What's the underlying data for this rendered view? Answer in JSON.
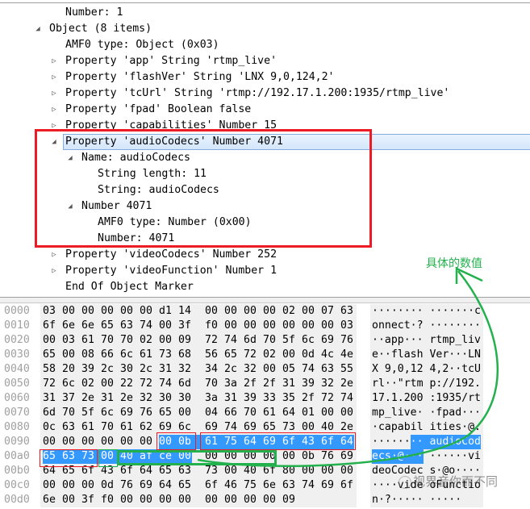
{
  "tree": [
    {
      "text": "Number: 1",
      "level": 2,
      "toggle": "none"
    },
    {
      "text": "Object (8 items)",
      "level": 1,
      "toggle": "expanded"
    },
    {
      "text": "AMF0 type: Object (0x03)",
      "level": 2,
      "toggle": "none"
    },
    {
      "text": "Property 'app' String 'rtmp_live'",
      "level": 2,
      "toggle": "collapsed"
    },
    {
      "text": "Property 'flashVer' String 'LNX 9,0,124,2'",
      "level": 2,
      "toggle": "collapsed"
    },
    {
      "text": "Property 'tcUrl' String 'rtmp://192.17.1.200:1935/rtmp_live'",
      "level": 2,
      "toggle": "collapsed"
    },
    {
      "text": "Property 'fpad' Boolean false",
      "level": 2,
      "toggle": "collapsed"
    },
    {
      "text": "Property 'capabilities' Number 15",
      "level": 2,
      "toggle": "collapsed"
    },
    {
      "text": "Property 'audioCodecs' Number 4071",
      "level": 2,
      "toggle": "expanded",
      "selected": true
    },
    {
      "text": "Name: audioCodecs",
      "level": 3,
      "toggle": "expanded"
    },
    {
      "text": "String length: 11",
      "level": 4,
      "toggle": "none"
    },
    {
      "text": "String: audioCodecs",
      "level": 4,
      "toggle": "none"
    },
    {
      "text": "Number 4071",
      "level": 3,
      "toggle": "expanded"
    },
    {
      "text": "AMF0 type: Number (0x00)",
      "level": 4,
      "toggle": "none"
    },
    {
      "text": "Number: 4071",
      "level": 4,
      "toggle": "none"
    },
    {
      "text": "Property 'videoCodecs' Number 252",
      "level": 2,
      "toggle": "collapsed"
    },
    {
      "text": "Property 'videoFunction' Number 1",
      "level": 2,
      "toggle": "collapsed"
    },
    {
      "text": "End Of Object Marker",
      "level": 2,
      "toggle": "none"
    }
  ],
  "hex_rows": [
    {
      "offset": "0000",
      "bytes": [
        "03",
        "00",
        "00",
        "00",
        "00",
        "00",
        "d1",
        "14",
        "00",
        "00",
        "00",
        "00",
        "02",
        "00",
        "07",
        "63"
      ],
      "ascii": "········ ·······c"
    },
    {
      "offset": "0010",
      "bytes": [
        "6f",
        "6e",
        "6e",
        "65",
        "63",
        "74",
        "00",
        "3f",
        "f0",
        "00",
        "00",
        "00",
        "00",
        "00",
        "00",
        "03"
      ],
      "ascii": "onnect·? ········"
    },
    {
      "offset": "0020",
      "bytes": [
        "00",
        "03",
        "61",
        "70",
        "70",
        "02",
        "00",
        "09",
        "72",
        "74",
        "6d",
        "70",
        "5f",
        "6c",
        "69",
        "76"
      ],
      "ascii": "··app··· rtmp_liv"
    },
    {
      "offset": "0030",
      "bytes": [
        "65",
        "00",
        "08",
        "66",
        "6c",
        "61",
        "73",
        "68",
        "56",
        "65",
        "72",
        "02",
        "00",
        "0d",
        "4c",
        "4e"
      ],
      "ascii": "e··flash Ver···LN"
    },
    {
      "offset": "0040",
      "bytes": [
        "58",
        "20",
        "39",
        "2c",
        "30",
        "2c",
        "31",
        "32",
        "34",
        "2c",
        "32",
        "00",
        "05",
        "74",
        "63",
        "55"
      ],
      "ascii": "X 9,0,12 4,2··tcU"
    },
    {
      "offset": "0050",
      "bytes": [
        "72",
        "6c",
        "02",
        "00",
        "22",
        "72",
        "74",
        "6d",
        "70",
        "3a",
        "2f",
        "2f",
        "31",
        "39",
        "32",
        "2e"
      ],
      "ascii": "rl··\"rtm p://192."
    },
    {
      "offset": "0060",
      "bytes": [
        "31",
        "37",
        "2e",
        "31",
        "2e",
        "32",
        "30",
        "30",
        "3a",
        "31",
        "39",
        "33",
        "35",
        "2f",
        "72",
        "74"
      ],
      "ascii": "17.1.200 :1935/rt"
    },
    {
      "offset": "0070",
      "bytes": [
        "6d",
        "70",
        "5f",
        "6c",
        "69",
        "76",
        "65",
        "00",
        "04",
        "66",
        "70",
        "61",
        "64",
        "01",
        "00",
        "00"
      ],
      "ascii": "mp_live· ·fpad···"
    },
    {
      "offset": "0080",
      "bytes": [
        "0c",
        "63",
        "61",
        "70",
        "61",
        "62",
        "69",
        "6c",
        "69",
        "74",
        "69",
        "65",
        "73",
        "00",
        "40",
        "2e"
      ],
      "ascii": "·capabil ities·@."
    },
    {
      "offset": "0090",
      "bytes": [
        "00",
        "00",
        "00",
        "00",
        "00",
        "00",
        "00",
        "0b",
        "61",
        "75",
        "64",
        "69",
        "6f",
        "43",
        "6f",
        "64"
      ],
      "ascii": "········ audioCod"
    },
    {
      "offset": "00a0",
      "bytes": [
        "65",
        "63",
        "73",
        "00",
        "40",
        "af",
        "ce",
        "00",
        "00",
        "00",
        "00",
        "00",
        "00",
        "0b",
        "76",
        "69"
      ],
      "ascii": "ecs·@··· ······vi"
    },
    {
      "offset": "00b0",
      "bytes": [
        "64",
        "65",
        "6f",
        "43",
        "6f",
        "64",
        "65",
        "63",
        "73",
        "00",
        "40",
        "6f",
        "80",
        "00",
        "00",
        "00"
      ],
      "ascii": "deoCodec s·@o····"
    },
    {
      "offset": "00c0",
      "bytes": [
        "00",
        "00",
        "00",
        "0d",
        "76",
        "69",
        "64",
        "65",
        "6f",
        "46",
        "75",
        "6e",
        "63",
        "74",
        "69",
        "6f"
      ],
      "ascii": "····vide oFunctio"
    },
    {
      "offset": "00d0",
      "bytes": [
        "6e",
        "00",
        "3f",
        "f0",
        "00",
        "00",
        "00",
        "00",
        "00",
        "00",
        "00",
        "00",
        "09"
      ],
      "ascii": "n·?····· ·····"
    }
  ],
  "selection": {
    "offset": 150,
    "length": 18,
    "color": "#3399ff"
  },
  "annotation": {
    "text": "具体的数值",
    "color": "#22b14c"
  },
  "highlight_colors": {
    "red": "#ed1c24",
    "green": "#22b14c"
  },
  "watermark": "视界音你而不同"
}
